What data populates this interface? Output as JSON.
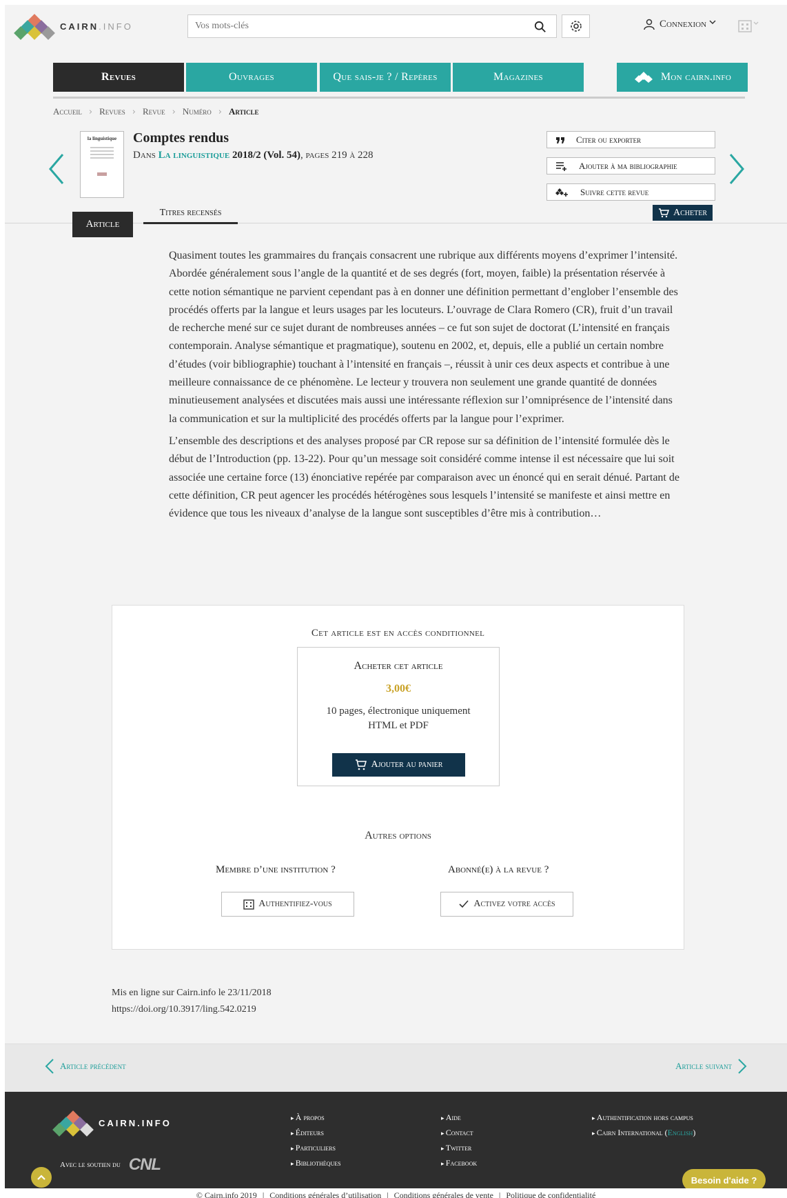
{
  "header": {
    "logo_text": "CAIRN",
    "logo_suffix": ".INFO",
    "search_placeholder": "Vos mots-clés",
    "login_label": "Connexion"
  },
  "nav": {
    "tabs": [
      "Revues",
      "Ouvrages",
      "Que sais-je ? / Repères",
      "Magazines",
      "Mon cairn.info"
    ]
  },
  "breadcrumb": [
    "Accueil",
    "Revues",
    "Revue",
    "Numéro",
    "Article"
  ],
  "article": {
    "title": "Comptes rendus",
    "in_label": "Dans",
    "journal": "La linguistique",
    "issue": "2018/2 (Vol. 54)",
    "pages": ", pages 219 à 228",
    "cover_title": "la linguistique",
    "actions": {
      "cite": "Citer ou exporter",
      "biblio": "Ajouter à ma bibliographie",
      "follow": "Suivre cette revue",
      "buy": "Acheter"
    },
    "tabs": {
      "article": "Article",
      "titres": "Titres recensés"
    },
    "paragraphs": [
      "Quasiment toutes les grammaires du français consacrent une rubrique aux différents moyens d’exprimer l’intensité. Abordée généralement sous l’angle de la quantité et de ses degrés (fort, moyen, faible) la présentation réservée à cette notion sémantique ne parvient cependant pas à en donner une définition permettant d’englober l’ensemble des procédés offerts par la langue et leurs usages par les locuteurs. L’ouvrage de Clara Romero (CR), fruit d’un travail de recherche mené sur ce sujet durant de nombreuses années – ce fut son sujet de doctorat (L’intensité en français contemporain. Analyse sémantique et pragmatique), soutenu en 2002, et, depuis, elle a publié un certain nombre d’études (voir bibliographie) touchant à l’intensité en français –, réussit à unir ces deux aspects et contribue à une meilleure connaissance de ce phénomène. Le lecteur y trouvera non seulement une grande quantité de données minutieusement analysées et discutées mais aussi une intéressante réflexion sur l’omniprésence de l’intensité dans la communication et sur la multiplicité des procédés offerts par la langue pour l’exprimer.",
      "L’ensemble des descriptions et des analyses proposé par CR repose sur sa définition de l’intensité formulée dès le début de l’Introduction (pp. 13-22). Pour qu’un message soit considéré comme intense il est nécessaire que lui soit associée une certaine force (13) énonciative repérée par comparaison avec un énoncé qui en serait dénué. Partant de cette définition, CR peut agencer les procédés hétérogènes sous lesquels l’intensité se manifeste et ainsi mettre en évidence que tous les niveaux d’analyse de la langue sont susceptibles d’être mis à contribution…"
    ]
  },
  "access": {
    "conditional": "Cet article est en accès conditionnel",
    "buy_title": "Acheter cet article",
    "price": "3,00€",
    "desc_line1": "10 pages, électronique uniquement",
    "desc_line2": "HTML et PDF",
    "add_to_cart": "Ajouter au panier",
    "other_options": "Autres options",
    "member_label": "Membre d’une institution ?",
    "member_button": "Authentifiez-vous",
    "subscriber_label": "Abonné(e) à la revue ?",
    "subscriber_button": "Activez votre accès"
  },
  "meta": {
    "online": "Mis en ligne sur Cairn.info le 23/11/2018",
    "doi": "https://doi.org/10.3917/ling.542.0219"
  },
  "pager": {
    "prev": "Article précédent",
    "next": "Article suivant"
  },
  "footer": {
    "logo_text": "CAIRN",
    "logo_suffix": ".INFO",
    "support": "Avec le soutien du",
    "cnl": "CNL",
    "col1": [
      "À propos",
      "Éditeurs",
      "Particuliers",
      "Bibliothèques"
    ],
    "col2": [
      "Aide",
      "Contact",
      "Twitter",
      "Facebook"
    ],
    "col3_a": "Authentification hors campus",
    "col3_b_pre": "Cairn International (",
    "col3_b_link": "English",
    "col3_b_post": ")",
    "help": "Besoin d'aide ?",
    "bottom": [
      "© Cairn.info 2019",
      "Conditions générales d’utilisation",
      "Conditions générales de vente",
      "Politique de confidentialité"
    ]
  },
  "colors": {
    "teal": "#2aa7a2",
    "dark": "#2b2b2b",
    "navy": "#11334a",
    "gold": "#c9a227"
  }
}
